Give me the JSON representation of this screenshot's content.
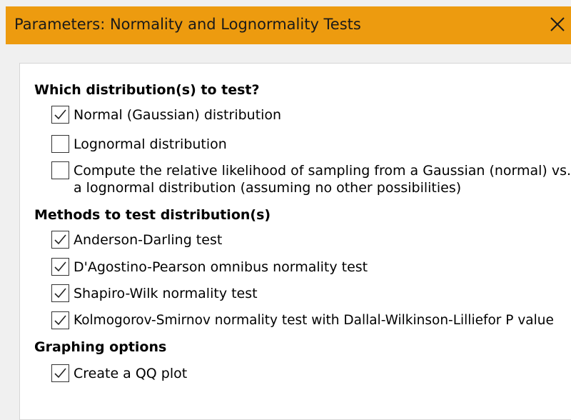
{
  "dialog": {
    "title": "Parameters: Normality and Lognormality Tests",
    "accent": "#ed9b0f"
  },
  "sections": {
    "distribution": {
      "heading": "Which distribution(s) to test?",
      "normal": {
        "label": "Normal (Gaussian) distribution",
        "checked": true
      },
      "lognormal": {
        "label": "Lognormal distribution",
        "checked": false
      },
      "likelihood": {
        "label_line1": "Compute the relative likelihood of sampling from a Gaussian (normal) vs.",
        "label_line2": "a lognormal distribution (assuming no other possibilities)",
        "checked": false
      }
    },
    "methods": {
      "heading": "Methods to test distribution(s)",
      "anderson": {
        "label": "Anderson-Darling test",
        "checked": true
      },
      "dagostino": {
        "label": "D'Agostino-Pearson omnibus normality test",
        "checked": true
      },
      "shapiro": {
        "label": "Shapiro-Wilk normality test",
        "checked": true
      },
      "kolmogorov": {
        "label": "Kolmogorov-Smirnov normality test with Dallal-Wilkinson-Lilliefor P value",
        "checked": true
      }
    },
    "graphing": {
      "heading": "Graphing options",
      "qqplot": {
        "label": "Create a QQ plot",
        "checked": true
      }
    }
  }
}
